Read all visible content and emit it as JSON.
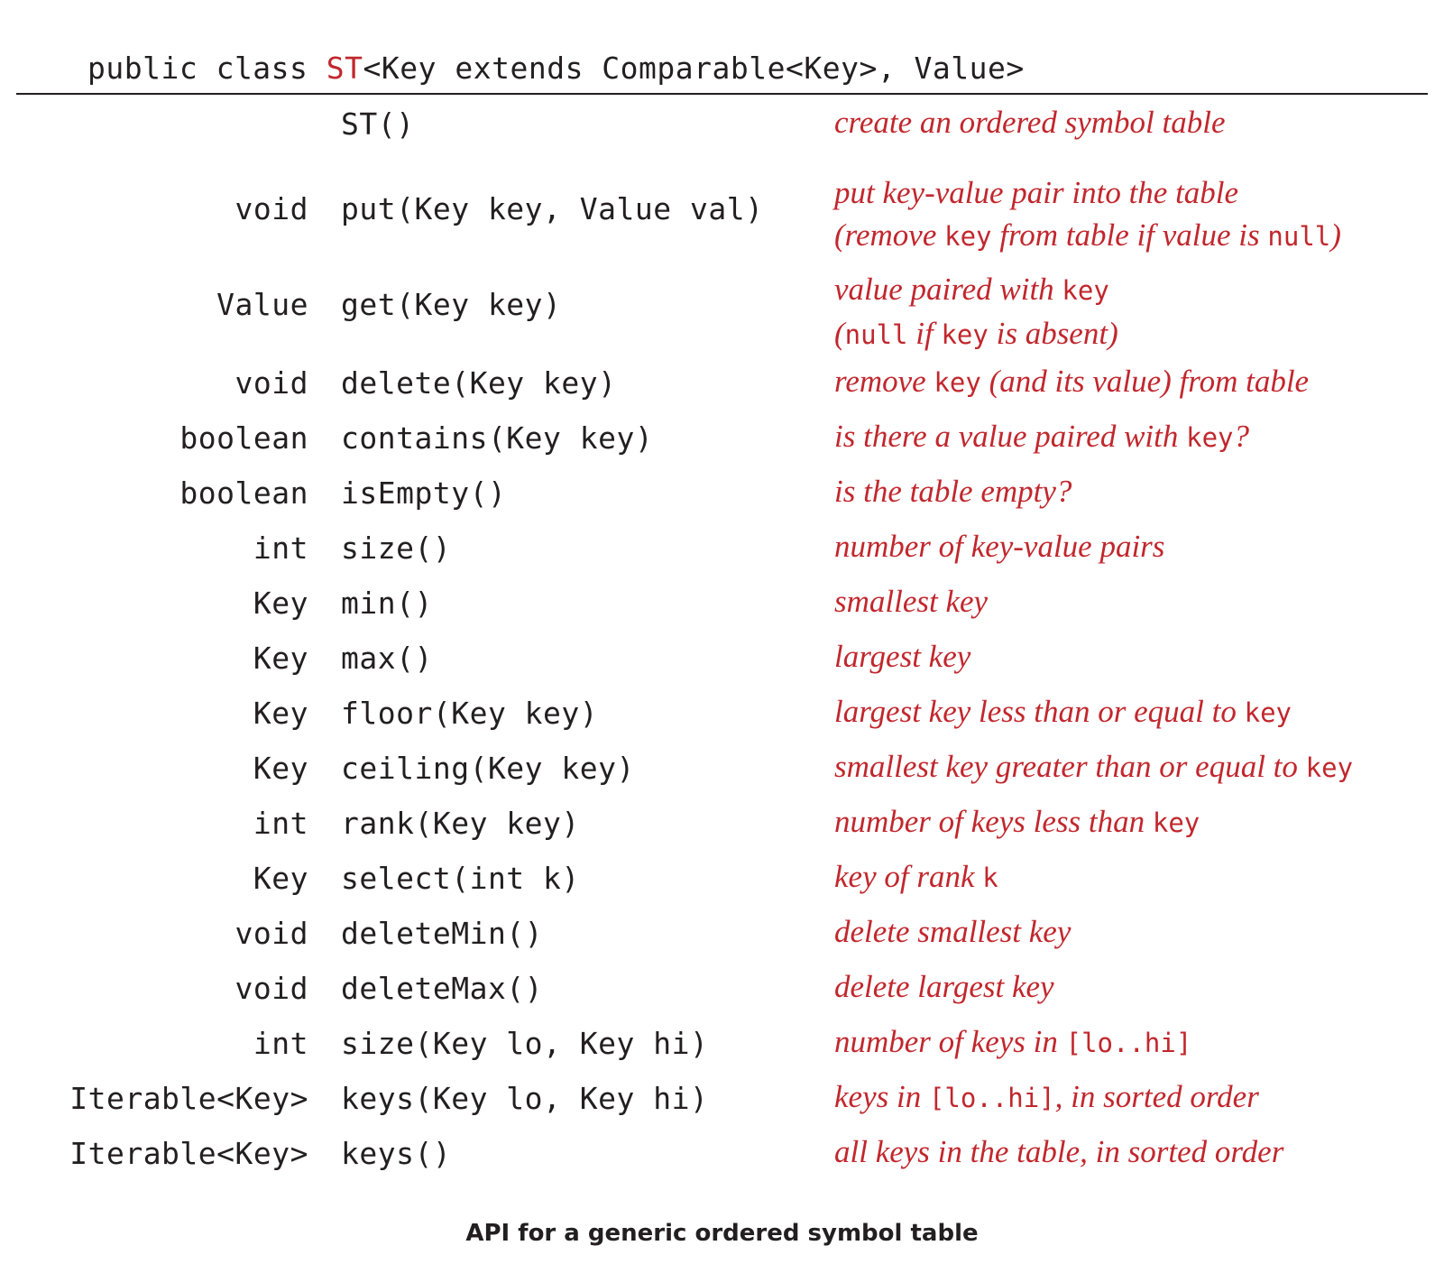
{
  "header": {
    "prefix": "public class ",
    "class_name": "ST",
    "suffix": "<Key extends Comparable<Key>, Value>"
  },
  "rows": [
    {
      "ret": "",
      "sig": "ST()",
      "desc": [
        [
          [
            "t",
            "create an ordered symbol table"
          ]
        ]
      ]
    },
    {
      "ret": "void",
      "sig": "put(Key key, Value val)",
      "desc": [
        [
          [
            "t",
            "put key-value pair into the table"
          ]
        ],
        [
          [
            "t",
            "(remove "
          ],
          [
            "c",
            "key"
          ],
          [
            "t",
            " from table if value is "
          ],
          [
            "c",
            "null"
          ],
          [
            "t",
            ")"
          ]
        ]
      ]
    },
    {
      "ret": "Value",
      "sig": "get(Key key)",
      "desc": [
        [
          [
            "t",
            "value paired with "
          ],
          [
            "c",
            "key"
          ]
        ],
        [
          [
            "t",
            "("
          ],
          [
            "c",
            "null"
          ],
          [
            "t",
            " if "
          ],
          [
            "c",
            "key"
          ],
          [
            "t",
            " is absent)"
          ]
        ]
      ]
    },
    {
      "ret": "void",
      "sig": "delete(Key key)",
      "desc": [
        [
          [
            "t",
            "remove "
          ],
          [
            "c",
            "key"
          ],
          [
            "t",
            " (and its value) from table"
          ]
        ]
      ]
    },
    {
      "ret": "boolean",
      "sig": "contains(Key key)",
      "desc": [
        [
          [
            "t",
            "is there a value paired with "
          ],
          [
            "c",
            "key"
          ],
          [
            "t",
            "?"
          ]
        ]
      ]
    },
    {
      "ret": "boolean",
      "sig": "isEmpty()",
      "desc": [
        [
          [
            "t",
            "is the table empty?"
          ]
        ]
      ]
    },
    {
      "ret": "int",
      "sig": "size()",
      "desc": [
        [
          [
            "t",
            "number of key-value pairs"
          ]
        ]
      ]
    },
    {
      "ret": "Key",
      "sig": "min()",
      "desc": [
        [
          [
            "t",
            "smallest key"
          ]
        ]
      ]
    },
    {
      "ret": "Key",
      "sig": "max()",
      "desc": [
        [
          [
            "t",
            "largest key"
          ]
        ]
      ]
    },
    {
      "ret": "Key",
      "sig": "floor(Key key)",
      "desc": [
        [
          [
            "t",
            "largest key less than or equal to "
          ],
          [
            "c",
            "key"
          ]
        ]
      ]
    },
    {
      "ret": "Key",
      "sig": "ceiling(Key key)",
      "desc": [
        [
          [
            "t",
            "smallest key greater than or equal to "
          ],
          [
            "c",
            "key"
          ]
        ]
      ]
    },
    {
      "ret": "int",
      "sig": "rank(Key key)",
      "desc": [
        [
          [
            "t",
            "number of keys less than "
          ],
          [
            "c",
            "key"
          ]
        ]
      ]
    },
    {
      "ret": "Key",
      "sig": "select(int k)",
      "desc": [
        [
          [
            "t",
            "key of rank "
          ],
          [
            "c",
            "k"
          ]
        ]
      ]
    },
    {
      "ret": "void",
      "sig": "deleteMin()",
      "desc": [
        [
          [
            "t",
            "delete smallest key"
          ]
        ]
      ]
    },
    {
      "ret": "void",
      "sig": "deleteMax()",
      "desc": [
        [
          [
            "t",
            "delete largest key"
          ]
        ]
      ]
    },
    {
      "ret": "int",
      "sig": "size(Key lo, Key hi)",
      "desc": [
        [
          [
            "t",
            "number of keys in "
          ],
          [
            "c",
            "[lo..hi]"
          ]
        ]
      ]
    },
    {
      "ret": "Iterable<Key>",
      "sig": "keys(Key lo, Key hi)",
      "desc": [
        [
          [
            "t",
            "keys in "
          ],
          [
            "c",
            "[lo..hi]"
          ],
          [
            "t",
            ", in sorted order"
          ]
        ]
      ]
    },
    {
      "ret": "Iterable<Key>",
      "sig": "keys()",
      "desc": [
        [
          [
            "t",
            "all keys in the table, in sorted order"
          ]
        ]
      ]
    }
  ],
  "caption": "API for a generic ordered symbol table"
}
